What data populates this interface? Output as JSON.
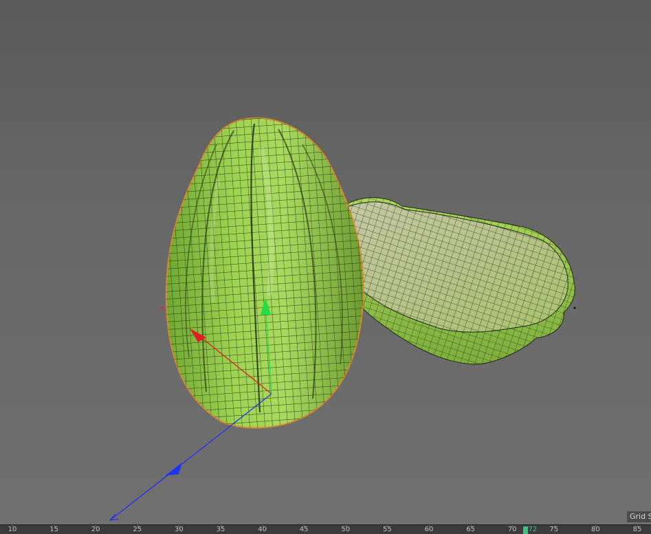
{
  "viewport": {
    "background_top": "#5a5a5a",
    "background_bottom": "#707070",
    "objects": [
      {
        "name": "chayote-front",
        "color": "#8fc845",
        "wire_color": "#1d2a10",
        "selected_outline": "#d98a2b"
      },
      {
        "name": "chayote-back",
        "color": "#9ccc55",
        "wire_color": "#1d2a10"
      }
    ],
    "gizmo": {
      "x_axis_color": "#e02020",
      "y_axis_color": "#22dd44",
      "z_axis_color": "#2233ee"
    },
    "grid_label": "Grid Spacing"
  },
  "timeline": {
    "ticks": [
      "10",
      "15",
      "20",
      "25",
      "30",
      "35",
      "40",
      "45",
      "50",
      "55",
      "60",
      "65",
      "70",
      "75",
      "80",
      "85"
    ],
    "current_frame": "72",
    "playhead_color": "#3fc37a"
  }
}
